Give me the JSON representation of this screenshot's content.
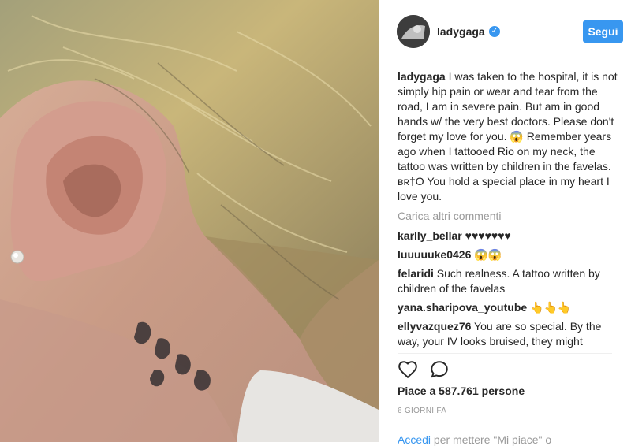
{
  "post": {
    "username": "ladygaga",
    "follow_label": "Segui",
    "caption_user": "ladygaga",
    "caption_text": "I was taken to the hospital, it is not simply hip pain or wear and tear from the road, I am in severe pain. But am in good hands w/ the very best doctors. Please don't forget my love for you. 😱 Remember years ago when I tattooed Rio on my neck, the tattoo was written by children in the favelas. ʙʀ†O You hold a special place in my heart I love you.",
    "load_more": "Carica altri commenti",
    "likes": "Piace a 587.761 persone",
    "time": "6 GIORNI FA",
    "login_link": "Accedi",
    "login_text": "per mettere \"Mi piace\" o"
  },
  "comments": [
    {
      "user": "karlly_bellar",
      "text": "♥♥♥♥♥♥♥"
    },
    {
      "user": "luuuuuke0426",
      "text": "😱😱"
    },
    {
      "user": "felaridi",
      "text": "Such realness. A tattoo written by children of the favelas"
    },
    {
      "user": "yana.sharipova_youtube",
      "text": "👆👆👆"
    },
    {
      "user": "ellyvazquez76",
      "text": "You are so special. By the way, your IV looks bruised, they might relocate it"
    }
  ],
  "icons": {
    "like": "heart-icon",
    "comment": "comment-bubble-icon",
    "verified": "verified-badge-icon"
  },
  "colors": {
    "accent": "#3897f0",
    "muted": "#999999"
  }
}
